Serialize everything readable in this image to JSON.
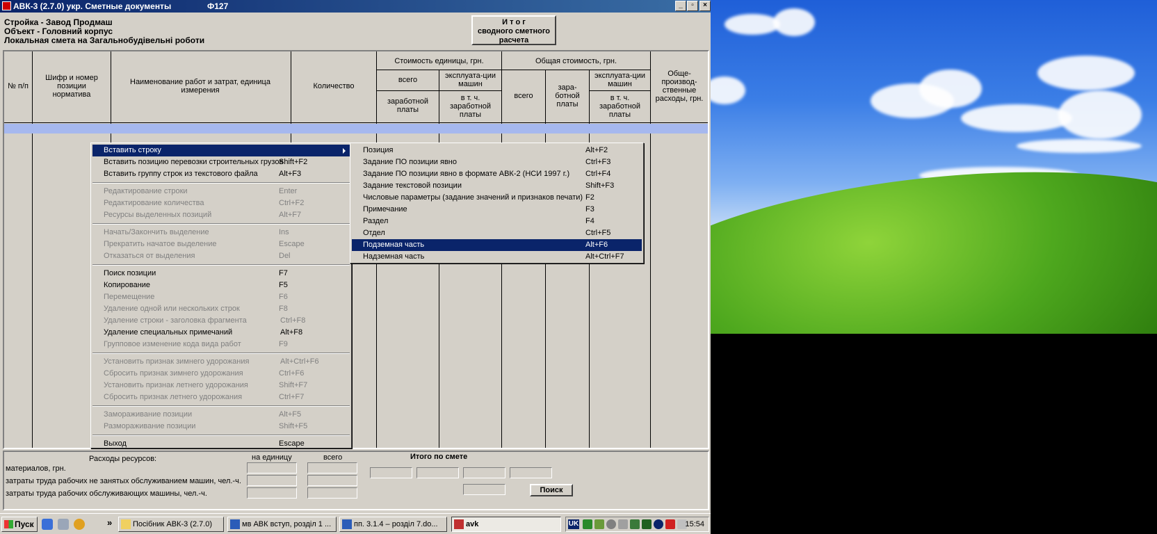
{
  "window": {
    "title": "АВК-3 (2.7.0)   укр.  Сметные документы",
    "form": "Ф127",
    "minimize": "_",
    "restore": "▫",
    "close": "×"
  },
  "header": {
    "line1": "Стройка - Завод Продмаш",
    "line2": "Объект - Головний корпус",
    "line3": "Локальная смета на Загальнобудівельні роботи",
    "itog_button": [
      "И т о г",
      "сводного сметного",
      "расчета"
    ]
  },
  "table_headers": {
    "num": "№ п/п",
    "code": "Шифр и номер позиции норматива",
    "name": "Наименование работ и затрат, единица измерения",
    "qty": "Количество",
    "unit_cost": "Стоимость единицы, грн.",
    "total_cost": "Общая стоимость, грн.",
    "vsego": "всего",
    "exploit": "эксплуата-ции машин",
    "zarab": "заработной платы",
    "incl_zarab": "в т. ч. заработной платы",
    "total_vsego": "всего",
    "total_zarab": "зара-ботной платы",
    "total_exploit": "эксплуата-ции машин",
    "total_incl": "в т. ч. заработной платы",
    "overhead": "Обще-производ-ственные расходы, грн."
  },
  "context_menu": [
    {
      "label": "Вставить строку",
      "key": "",
      "state": "highlight",
      "submenu": true
    },
    {
      "label": "Вставить позицию перевозки строительных грузов",
      "key": "Shift+F2",
      "state": "enabled"
    },
    {
      "label": "Вставить группу строк из текстового файла",
      "key": "Alt+F3",
      "state": "enabled"
    },
    {
      "label": "Редактирование строки",
      "key": "Enter",
      "state": "disabled"
    },
    {
      "label": "Редактирование количества",
      "key": "Ctrl+F2",
      "state": "disabled"
    },
    {
      "label": "Ресурсы выделенных позиций",
      "key": "Alt+F7",
      "state": "disabled"
    },
    {
      "label": "Начать/Закончить выделение",
      "key": "Ins",
      "state": "disabled"
    },
    {
      "label": "Прекратить начатое выделение",
      "key": "Escape",
      "state": "disabled"
    },
    {
      "label": "Отказаться от выделения",
      "key": "Del",
      "state": "disabled"
    },
    {
      "label": "Поиск позиции",
      "key": "F7",
      "state": "enabled"
    },
    {
      "label": "Копирование",
      "key": "F5",
      "state": "enabled"
    },
    {
      "label": "Перемещение",
      "key": "F6",
      "state": "disabled"
    },
    {
      "label": "Удаление одной или нескольких строк",
      "key": "F8",
      "state": "disabled"
    },
    {
      "label": "Удаление строки - заголовка фрагмента",
      "key": "Ctrl+F8",
      "state": "disabled"
    },
    {
      "label": "Удаление специальных примечаний",
      "key": "Alt+F8",
      "state": "enabled"
    },
    {
      "label": "Групповое изменение кода вида работ",
      "key": "F9",
      "state": "disabled"
    },
    {
      "label": "Установить признак зимнего удорожания",
      "key": "Alt+Ctrl+F6",
      "state": "disabled"
    },
    {
      "label": "Сбросить признак зимнего удорожания",
      "key": "Ctrl+F6",
      "state": "disabled"
    },
    {
      "label": "Установить признак летнего удорожания",
      "key": "Shift+F7",
      "state": "disabled"
    },
    {
      "label": "Сбросить признак летнего удорожания",
      "key": "Ctrl+F7",
      "state": "disabled"
    },
    {
      "label": "Замораживание позиции",
      "key": "Alt+F5",
      "state": "disabled"
    },
    {
      "label": "Размораживание позиции",
      "key": "Shift+F5",
      "state": "disabled"
    },
    {
      "label": "Выход",
      "key": "Escape",
      "state": "enabled"
    }
  ],
  "submenu": [
    {
      "label": "Позиция",
      "key": "Alt+F2"
    },
    {
      "label": "Задание ПО позиции явно",
      "key": "Ctrl+F3"
    },
    {
      "label": "Задание ПО позиции явно в формате АВК-2 (НСИ 1997 г.)",
      "key": "Ctrl+F4"
    },
    {
      "label": "Задание текстовой позиции",
      "key": "Shift+F3"
    },
    {
      "label": "Числовые параметры (задание значений и признаков печати)",
      "key": "F2"
    },
    {
      "label": "Примечание",
      "key": "F3"
    },
    {
      "label": "Раздел",
      "key": "F4"
    },
    {
      "label": "Отдел",
      "key": "Ctrl+F5"
    },
    {
      "label": "Подземная часть",
      "key": "Alt+F6",
      "state": "highlight"
    },
    {
      "label": "Надземная часть",
      "key": "Alt+Ctrl+F7"
    }
  ],
  "resources": {
    "title": "Расходы ресурсов:",
    "col_unit": "на единицу",
    "col_total": "всего",
    "row1": "материалов, грн.",
    "row2": "затраты труда рабочих не занятых обслуживанием машин, чел.-ч.",
    "row3": "затраты труда рабочих обслуживающих машины, чел.-ч.",
    "itogo": "Итого    по    смете",
    "search_button": "Поиск"
  },
  "taskbar": {
    "start": "Пуск",
    "tasks": [
      {
        "label": "Посібник АВК-3 (2.7.0)",
        "active": false
      },
      {
        "label": "мв АВК вступ, розділ 1 ...",
        "active": false
      },
      {
        "label": "пп. 3.1.4 – розділ 7.do...",
        "active": false
      },
      {
        "label": "avk",
        "active": true
      }
    ],
    "chevron": "»",
    "lang": "UK",
    "clock": "15:54"
  }
}
